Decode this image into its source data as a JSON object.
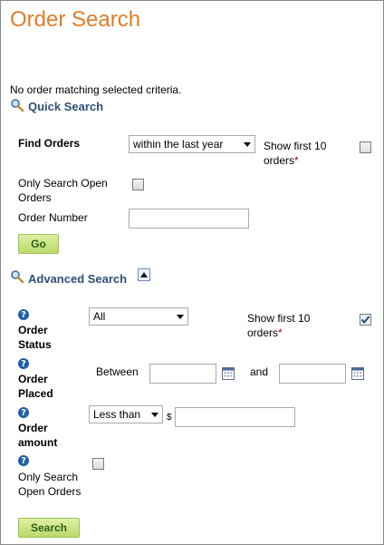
{
  "title": "Order Search",
  "message": "No order matching selected criteria.",
  "quick": {
    "heading": "Quick Search",
    "find_orders_label": "Find Orders",
    "range_value": "within the last year",
    "show_first_line1": "Show first 10",
    "show_first_line2": "orders",
    "required_mark": "*",
    "show_first_checked": false,
    "open_line1": "Only Search Open",
    "open_line2": "Orders",
    "open_checked": false,
    "order_number_label": "Order Number",
    "order_number_value": "",
    "go_label": "Go"
  },
  "advanced": {
    "heading": "Advanced Search",
    "status_line1": "Order",
    "status_line2": "Status",
    "status_value": "All",
    "show_first_line1": "Show first 10",
    "show_first_line2": "orders",
    "required_mark": "*",
    "show_first_checked": true,
    "placed_line1": "Order",
    "placed_line2": "Placed",
    "between_label": "Between",
    "and_label": "and",
    "date_from": "",
    "date_to": "",
    "amount_line1": "Order",
    "amount_line2": "amount",
    "amount_comparator": "Less than",
    "currency_symbol": "$",
    "amount_value": "",
    "open_line1": "Only Search",
    "open_line2": "Open Orders",
    "open_checked": false,
    "search_label": "Search"
  },
  "icons": {
    "help": "help-icon",
    "magnifier": "magnifier-icon",
    "calendar": "calendar-icon",
    "collapse": "chevron-up-icon"
  },
  "colors": {
    "title": "#e07c26",
    "section_heading": "#2f4f79",
    "button": "#b9da6a",
    "required": "#c00000",
    "help": "#1f5fa8"
  }
}
